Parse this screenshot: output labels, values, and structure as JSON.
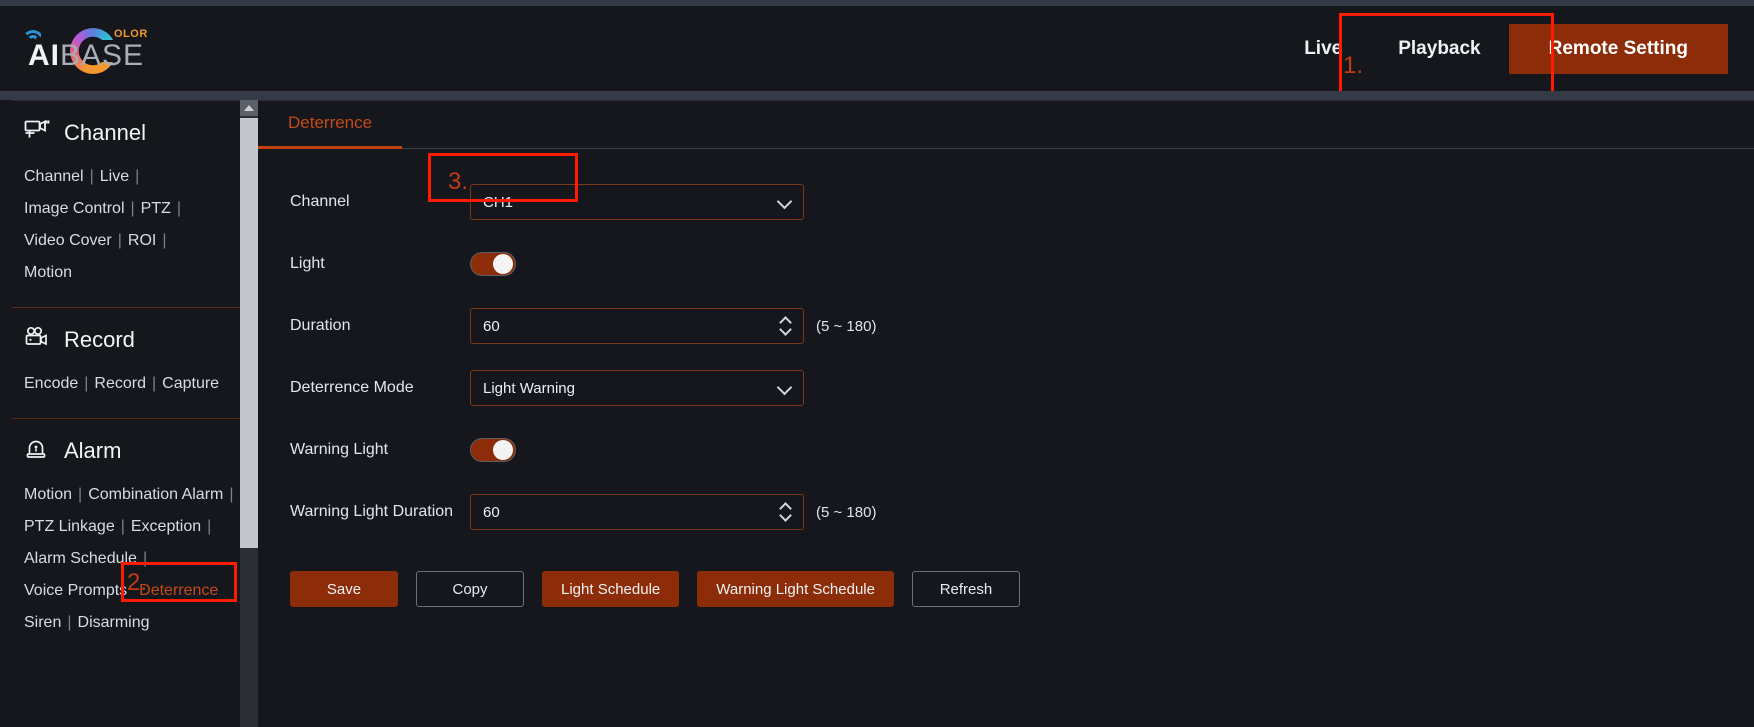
{
  "brand": {
    "name_ai": "AI",
    "name_base": "BASE",
    "superscript": "OLOR",
    "arc_icon": "wifi-arc-icon",
    "ring_icon": "color-ring-icon"
  },
  "header": {
    "nav": [
      {
        "label": "Live",
        "name": "nav-live",
        "active": false
      },
      {
        "label": "Playback",
        "name": "nav-playback",
        "active": false
      },
      {
        "label": "Remote Setting",
        "name": "nav-remote-setting",
        "active": true
      }
    ]
  },
  "annotations": [
    {
      "id": "1",
      "number": "1.",
      "target": "Remote Setting"
    },
    {
      "id": "2",
      "number": "2.",
      "target": "Deterrence"
    },
    {
      "id": "3",
      "number": "3.",
      "target": "CH1"
    }
  ],
  "sidebar": {
    "groups": [
      {
        "title": "Channel",
        "icon": "camera-icon",
        "links": [
          {
            "label": "Channel",
            "active": false
          },
          {
            "label": "Live",
            "active": false
          },
          {
            "label": "Image Control",
            "active": false
          },
          {
            "label": "PTZ",
            "active": false
          },
          {
            "label": "Video Cover",
            "active": false
          },
          {
            "label": "ROI",
            "active": false
          },
          {
            "label": "Motion",
            "active": false
          }
        ]
      },
      {
        "title": "Record",
        "icon": "video-recorder-icon",
        "links": [
          {
            "label": "Encode",
            "active": false
          },
          {
            "label": "Record",
            "active": false
          },
          {
            "label": "Capture",
            "active": false
          }
        ]
      },
      {
        "title": "Alarm",
        "icon": "siren-icon",
        "links": [
          {
            "label": "Motion",
            "active": false
          },
          {
            "label": "Combination Alarm",
            "active": false
          },
          {
            "label": "PTZ Linkage",
            "active": false
          },
          {
            "label": "Exception",
            "active": false
          },
          {
            "label": "Alarm Schedule",
            "active": false
          },
          {
            "label": "Voice Prompts",
            "active": false
          },
          {
            "label": "Deterrence",
            "active": true
          },
          {
            "label": "Siren",
            "active": false
          },
          {
            "label": "Disarming",
            "active": false
          }
        ]
      }
    ],
    "separator": "|"
  },
  "main": {
    "tabs": [
      {
        "label": "Deterrence",
        "active": true
      }
    ],
    "fields": {
      "channel": {
        "label": "Channel",
        "value": "CH1",
        "icon": "chevron-down-icon"
      },
      "light": {
        "label": "Light",
        "value": "on"
      },
      "duration": {
        "label": "Duration",
        "value": "60",
        "hint": "(5 ~ 180)",
        "icon": "stepper-icon"
      },
      "deterrence_mode": {
        "label": "Deterrence Mode",
        "value": "Light Warning",
        "icon": "chevron-down-icon"
      },
      "warning_light": {
        "label": "Warning Light",
        "value": "on"
      },
      "warning_light_duration": {
        "label": "Warning Light Duration",
        "value": "60",
        "hint": "(5 ~ 180)",
        "icon": "stepper-icon"
      }
    },
    "buttons": [
      {
        "label": "Save",
        "style": "filled",
        "name": "save-button"
      },
      {
        "label": "Copy",
        "style": "outline",
        "name": "copy-button"
      },
      {
        "label": "Light Schedule",
        "style": "filled",
        "name": "light-schedule-button"
      },
      {
        "label": "Warning Light Schedule",
        "style": "filled",
        "name": "warning-light-schedule-button"
      },
      {
        "label": "Refresh",
        "style": "outline",
        "name": "refresh-button"
      }
    ]
  },
  "colors": {
    "accent": "#8c2c08",
    "accent_text": "#c24a18",
    "annotation": "#ff1b00",
    "background": "#15171c"
  }
}
